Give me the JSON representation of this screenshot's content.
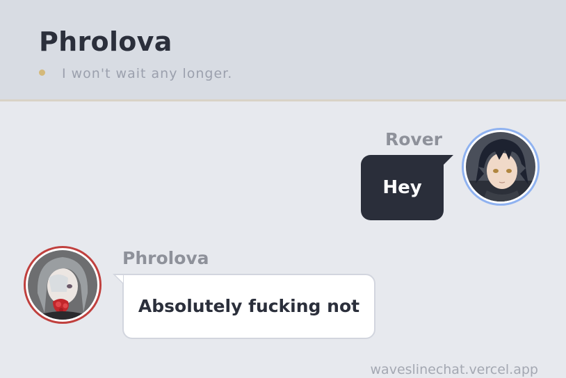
{
  "header": {
    "title": "Phrolova",
    "status": "I won't wait any longer.",
    "status_dot_color": "#d4b97a"
  },
  "messages": [
    {
      "sender": "Rover",
      "text": "Hey",
      "side": "right",
      "avatar_ring_color": "#8fb2f0"
    },
    {
      "sender": "Phrolova",
      "text": "Absolutely fucking not",
      "side": "left",
      "avatar_ring_color": "#c0403e"
    }
  ],
  "footer": {
    "watermark": "waveslinechat.vercel.app"
  }
}
